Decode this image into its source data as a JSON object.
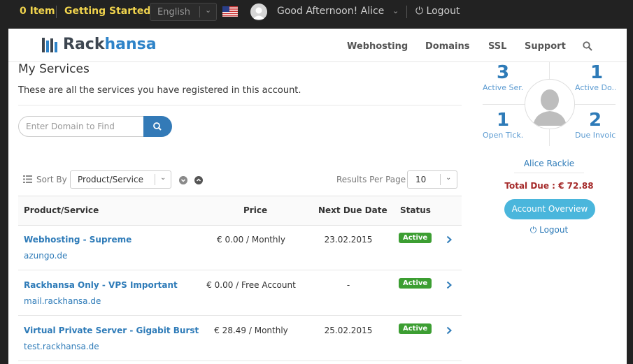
{
  "topbar": {
    "cart_count": "0",
    "cart_label": "Item",
    "getting_started": "Getting Started",
    "language": "English",
    "greeting": "Good Afternoon! Alice",
    "logout": "Logout"
  },
  "brand": {
    "part1": "Rack",
    "part2": "hansa"
  },
  "nav": {
    "items": [
      "Webhosting",
      "Domains",
      "SSL",
      "Support"
    ]
  },
  "main": {
    "title": "My Services",
    "subtitle": "These are all the services you have registered in this account.",
    "search_placeholder": "Enter Domain to Find",
    "sort_by_label": "Sort By",
    "sort_value": "Product/Service",
    "results_per_page_label": "Results Per Page",
    "results_per_page_value": "10"
  },
  "table": {
    "headers": {
      "product": "Product/Service",
      "price": "Price",
      "due": "Next Due Date",
      "status": "Status"
    },
    "rows": [
      {
        "name": "Webhosting - Supreme",
        "domain": "azungo.de",
        "price": "€ 0.00 / Monthly",
        "due": "23.02.2015",
        "status": "Active"
      },
      {
        "name": "Rackhansa Only - VPS Important",
        "domain": "mail.rackhansa.de",
        "price": "€ 0.00 / Free Account",
        "due": "-",
        "status": "Active"
      },
      {
        "name": "Virtual Private Server - Gigabit Burst",
        "domain": "test.rackhansa.de",
        "price": "€ 28.49 / Monthly",
        "due": "25.02.2015",
        "status": "Active"
      }
    ]
  },
  "sidebar": {
    "stats": [
      {
        "value": "3",
        "label": "Active Ser..."
      },
      {
        "value": "1",
        "label": "Active Do..."
      },
      {
        "value": "1",
        "label": "Open Tick..."
      },
      {
        "value": "2",
        "label": "Due Invoic..."
      }
    ],
    "user_name": "Alice Rackie",
    "total_due": "Total Due : € 72.88",
    "account_overview": "Account Overview",
    "logout": "Logout"
  },
  "colors": {
    "accent": "#2e7bb8",
    "button_blue": "#337ab7",
    "overview_button": "#4ab6dc",
    "active_badge": "#3c9e32",
    "total_due": "#a52a2a",
    "topbar_highlight": "#f0d34d"
  }
}
